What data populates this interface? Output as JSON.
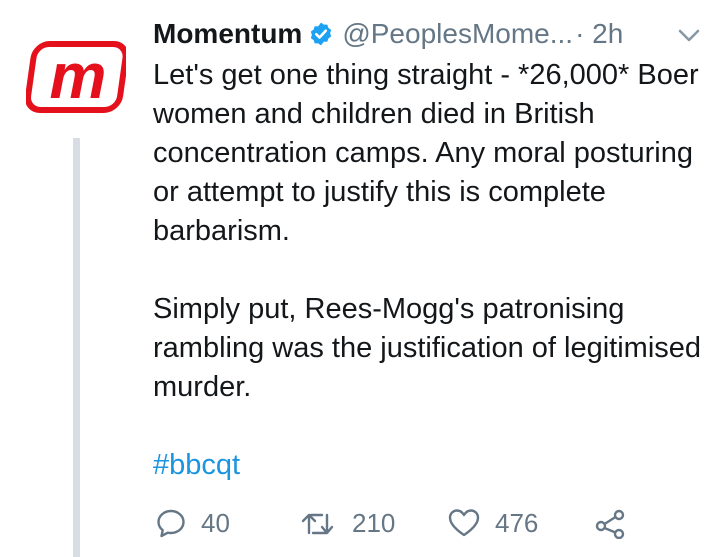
{
  "tweet": {
    "display_name": "Momentum",
    "handle": "@PeoplesMome...",
    "time": "· 2h",
    "paragraphs": [
      "Let's get one thing straight - *26,000* Boer women and children died in British concentration camps. Any moral posturing or attempt to justify this is complete barbarism.",
      "Simply put, Rees-Mogg's patronising rambling was the justification of legitimised murder."
    ],
    "hashtag": "#bbcqt",
    "counts": {
      "replies": "40",
      "retweets": "210",
      "likes": "476"
    }
  },
  "avatar": {
    "logo_letter": "m"
  },
  "icons": {
    "verified": "verified-badge-icon",
    "more": "chevron-down-icon",
    "reply": "reply-icon",
    "retweet": "retweet-icon",
    "like": "heart-icon",
    "share": "share-icon"
  },
  "colors": {
    "brand_red": "#e4111c",
    "verified_blue": "#1da1f2",
    "link_blue": "#1b95e0",
    "muted_gray": "#657786",
    "thread_line": "#d7dde2"
  }
}
